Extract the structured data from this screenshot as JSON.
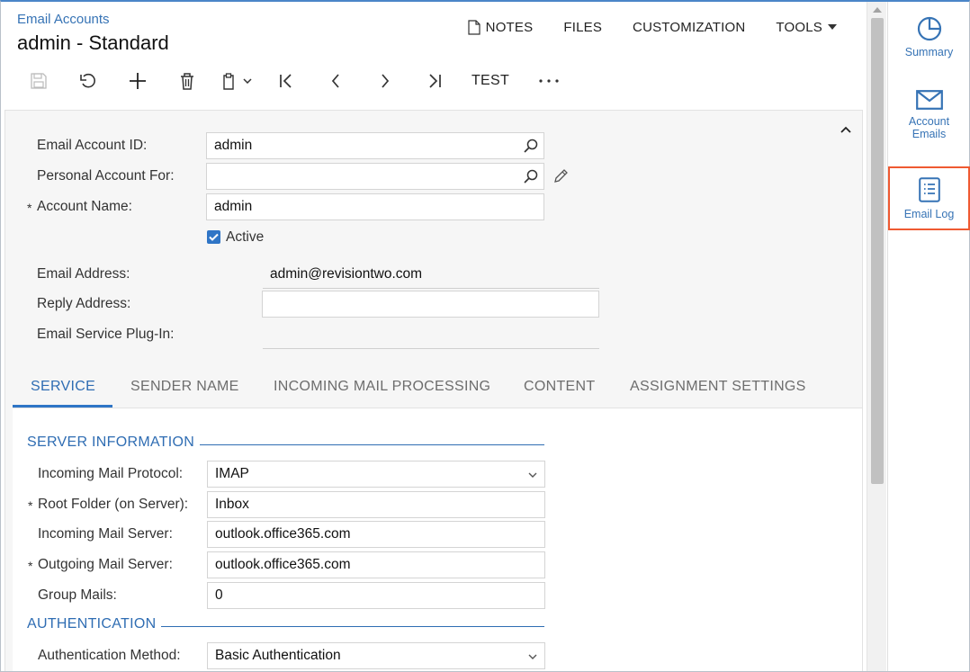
{
  "header": {
    "breadcrumb": "Email Accounts",
    "title": "admin - Standard",
    "menu": {
      "notes": "NOTES",
      "files": "FILES",
      "customization": "CUSTOMIZATION",
      "tools": "TOOLS"
    }
  },
  "toolbar": {
    "icons": [
      "save-icon",
      "undo-icon",
      "add-icon",
      "delete-icon",
      "copy-paste-icon",
      "first-record-icon",
      "previous-record-icon",
      "next-record-icon",
      "last-record-icon",
      "more-icon"
    ],
    "test_label": "TEST",
    "more_label": "···"
  },
  "form": {
    "required_mark": "*",
    "email_account_id": {
      "label": "Email Account ID:",
      "value": "admin"
    },
    "personal_account_for": {
      "label": "Personal Account For:",
      "value": ""
    },
    "account_name": {
      "label": "Account Name:",
      "value": "admin"
    },
    "active": {
      "label": "Active",
      "checked": true
    },
    "email_address": {
      "label": "Email Address:",
      "value": "admin@revisiontwo.com"
    },
    "reply_address": {
      "label": "Reply Address:",
      "value": ""
    },
    "email_service_plugin": {
      "label": "Email Service Plug-In:",
      "value": ""
    }
  },
  "tabs": [
    {
      "label": "SERVICE",
      "active": true
    },
    {
      "label": "SENDER NAME"
    },
    {
      "label": "INCOMING MAIL PROCESSING"
    },
    {
      "label": "CONTENT"
    },
    {
      "label": "ASSIGNMENT SETTINGS"
    }
  ],
  "service": {
    "server_information": {
      "title": "SERVER INFORMATION",
      "incoming_mail_protocol": {
        "label": "Incoming Mail Protocol:",
        "value": "IMAP"
      },
      "root_folder": {
        "label": "Root Folder (on Server):",
        "value": "Inbox"
      },
      "incoming_mail_server": {
        "label": "Incoming Mail Server:",
        "value": "outlook.office365.com"
      },
      "outgoing_mail_server": {
        "label": "Outgoing Mail Server:",
        "value": "outlook.office365.com"
      },
      "group_mails": {
        "label": "Group Mails:",
        "value": "0"
      }
    },
    "authentication": {
      "title": "AUTHENTICATION",
      "authentication_method": {
        "label": "Authentication Method:",
        "value": "Basic Authentication"
      }
    }
  },
  "right_panel": {
    "items": [
      {
        "label": "Summary",
        "icon": "pie-chart-icon"
      },
      {
        "label": "Account Emails",
        "icon": "envelope-icon"
      },
      {
        "label": "Email Log",
        "icon": "list-document-icon",
        "highlighted": true
      }
    ]
  },
  "colors": {
    "accent": "#2f75c6",
    "link": "#3673b5",
    "highlight": "#ef5a32"
  }
}
